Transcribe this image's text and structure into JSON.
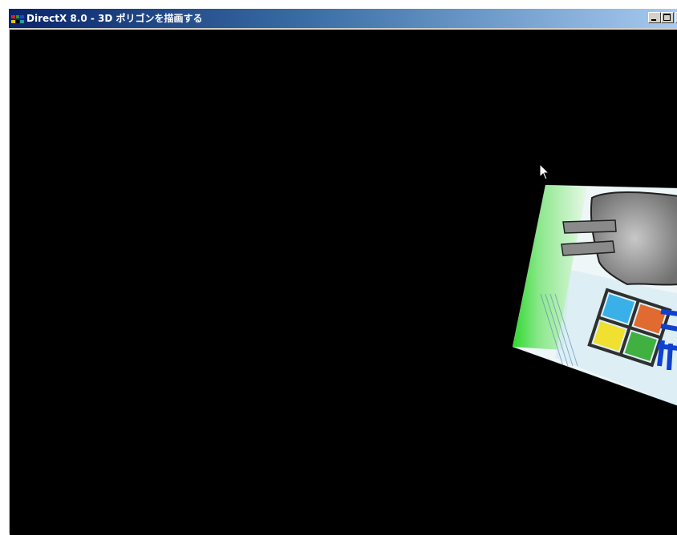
{
  "window": {
    "title": "DirectX 8.0 - 3D ポリゴンを描画する",
    "icon": "directx-app-icon",
    "caption_buttons": [
      "minimize-icon",
      "maximize-icon",
      "close-icon"
    ]
  },
  "viewport": {
    "background": "#000000",
    "content": "textured-quad-polygon",
    "cursor": "arrow-cursor-icon"
  },
  "colors": {
    "titlebar_start": "#0a246a",
    "titlebar_end": "#a6caf0",
    "title_text": "#ffffff"
  }
}
